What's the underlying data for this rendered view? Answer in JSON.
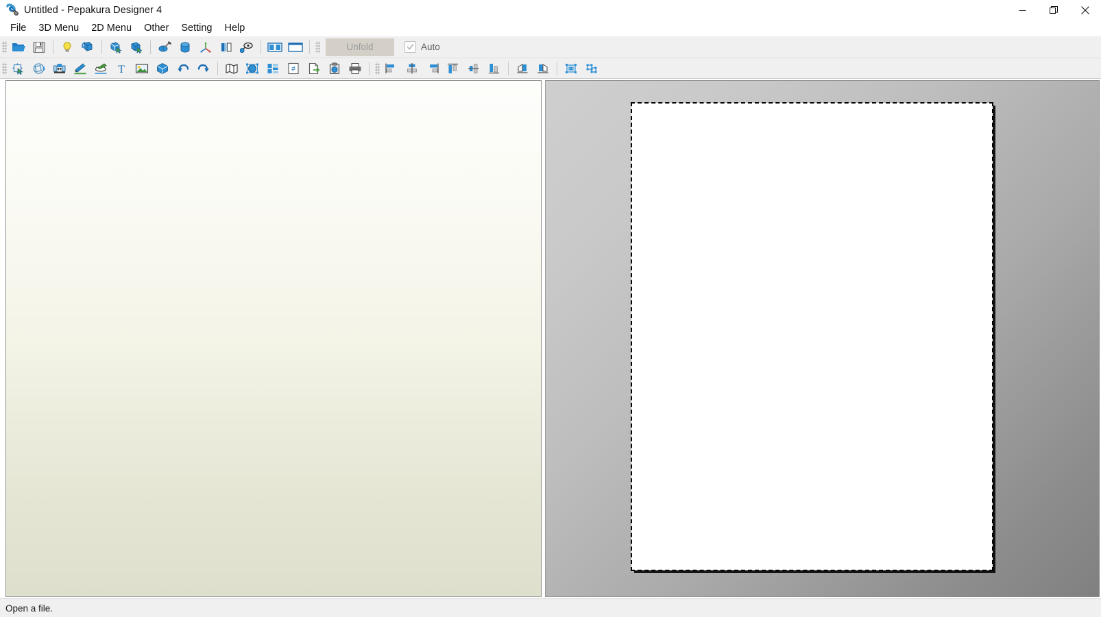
{
  "window": {
    "title": "Untitled - Pepakura Designer 4",
    "app_icon": "pepakura-app-icon",
    "controls": [
      {
        "name": "minimize",
        "glyph": "minimize-icon"
      },
      {
        "name": "restore",
        "glyph": "restore-icon"
      },
      {
        "name": "close",
        "glyph": "close-icon"
      }
    ]
  },
  "menubar": {
    "items": [
      {
        "label": "File",
        "name": "file"
      },
      {
        "label": "3D Menu",
        "name": "3d-menu"
      },
      {
        "label": "2D Menu",
        "name": "2d-menu"
      },
      {
        "label": "Other",
        "name": "other"
      },
      {
        "label": "Setting",
        "name": "setting"
      },
      {
        "label": "Help",
        "name": "help"
      }
    ],
    "annotation": {
      "target": "File",
      "shape": "ellipse",
      "color": "#ee0000"
    }
  },
  "toolbar_main": {
    "groups": [
      {
        "items": [
          {
            "name": "open-file-icon",
            "title": "Open"
          },
          {
            "name": "save-file-icon",
            "title": "Save"
          }
        ]
      },
      {
        "items": [
          {
            "name": "lightbulb-icon",
            "title": "Light"
          },
          {
            "name": "rotate-model-icon",
            "title": "Rotate"
          }
        ]
      },
      {
        "items": [
          {
            "name": "select-face-icon",
            "title": "Select Face"
          },
          {
            "name": "select-part-icon",
            "title": "Select Part"
          }
        ]
      },
      {
        "items": [
          {
            "name": "paint-model-icon",
            "title": "Paint"
          },
          {
            "name": "cylinder-icon",
            "title": "Cylinder"
          },
          {
            "name": "axis-icon",
            "title": "Axis"
          },
          {
            "name": "texture-split-icon",
            "title": "Texture"
          },
          {
            "name": "magnifier-icon",
            "title": "Zoom"
          }
        ]
      },
      {
        "items": [
          {
            "name": "split-view-icon",
            "title": "Split View"
          },
          {
            "name": "single-view-icon",
            "title": "Single View"
          }
        ]
      }
    ],
    "unfold": {
      "label": "Unfold",
      "enabled": false
    },
    "auto": {
      "label": "Auto",
      "checked": true,
      "enabled": false
    }
  },
  "toolbar_2d": {
    "groups": [
      {
        "items": [
          {
            "name": "move-part-icon",
            "title": "Move Part"
          },
          {
            "name": "rotate-part-icon",
            "title": "Rotate Part"
          },
          {
            "name": "join-disjoin-icon",
            "title": "Join/Disjoin Face"
          },
          {
            "name": "edit-line-icon",
            "title": "Edit Flap"
          },
          {
            "name": "edit-flap-icon",
            "title": "Edit Flap Shape"
          },
          {
            "name": "text-tool-icon",
            "title": "Add Text"
          },
          {
            "name": "image-tool-icon",
            "title": "Add Image"
          },
          {
            "name": "box-tool-icon",
            "title": "3D Model"
          },
          {
            "name": "undo-icon",
            "title": "Undo"
          },
          {
            "name": "redo-icon",
            "title": "Redo"
          }
        ]
      },
      {
        "items": [
          {
            "name": "unfold-map-icon",
            "title": "Unfold Map"
          },
          {
            "name": "select-all-parts-icon",
            "title": "Select Parts"
          },
          {
            "name": "layout-icon",
            "title": "Layout"
          },
          {
            "name": "number-page-icon",
            "title": "Numbering"
          },
          {
            "name": "export-icon",
            "title": "Export"
          },
          {
            "name": "clipboard-icon",
            "title": "Copy"
          },
          {
            "name": "print-icon",
            "title": "Print"
          }
        ]
      },
      {
        "items": [
          {
            "name": "align-left-icon",
            "title": "Align Left"
          },
          {
            "name": "align-center-h-icon",
            "title": "Align Center"
          },
          {
            "name": "align-right-icon",
            "title": "Align Right"
          },
          {
            "name": "align-top-icon",
            "title": "Align Top"
          },
          {
            "name": "align-middle-v-icon",
            "title": "Align Middle"
          },
          {
            "name": "align-bottom-icon",
            "title": "Align Bottom"
          }
        ]
      },
      {
        "items": [
          {
            "name": "flip-horizontal-icon",
            "title": "Flip Horizontal"
          },
          {
            "name": "flip-vertical-icon",
            "title": "Flip Vertical"
          }
        ]
      },
      {
        "items": [
          {
            "name": "group-icon",
            "title": "Group"
          },
          {
            "name": "ungroup-icon",
            "title": "Ungroup"
          }
        ]
      }
    ]
  },
  "panels": {
    "view3d": {
      "name": "3d-view",
      "content": ""
    },
    "view2d": {
      "name": "2d-view",
      "paper": {
        "name": "paper-sheet",
        "content": ""
      }
    }
  },
  "statusbar": {
    "message": "Open a file."
  },
  "colors": {
    "accent_blue": "#1f7cc4",
    "toolbar_bg": "#f0f0f0",
    "panel3d_top": "#fdfdfb",
    "panel3d_bottom": "#dedfcc",
    "panel2d_light": "#cfcfcf",
    "panel2d_dark": "#808080",
    "annotation_red": "#ee0000"
  }
}
